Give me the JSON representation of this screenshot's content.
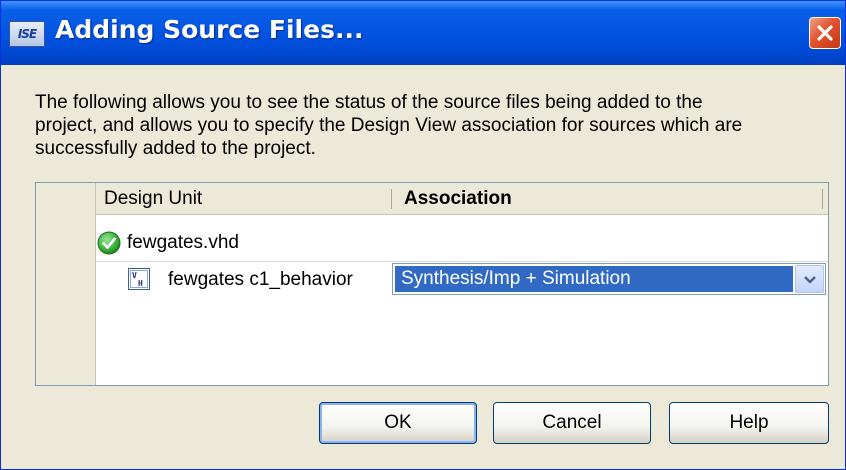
{
  "window": {
    "title": "Adding Source Files...",
    "app_icon_text": "ISE"
  },
  "description": {
    "line1": "The following allows you to see the status of the source files being added to the",
    "line2": "project, and allows you to specify the Design View association for sources which are",
    "line3": "successfully added to the project."
  },
  "grid": {
    "columns": {
      "design_unit": "Design Unit",
      "association": "Association"
    },
    "rows": [
      {
        "icon": "check-circle-icon",
        "label": "fewgates.vhd"
      },
      {
        "icon": "vhdl-entity-icon",
        "label": "fewgates c1_behavior",
        "association": "Synthesis/Imp + Simulation"
      }
    ]
  },
  "buttons": {
    "ok": "OK",
    "cancel": "Cancel",
    "help": "Help"
  },
  "colors": {
    "title_bar": "#0053e0",
    "dialog_bg": "#ece9d8",
    "selection": "#316ac5",
    "close_button": "#e0532d",
    "success_icon": "#3fb63f"
  }
}
